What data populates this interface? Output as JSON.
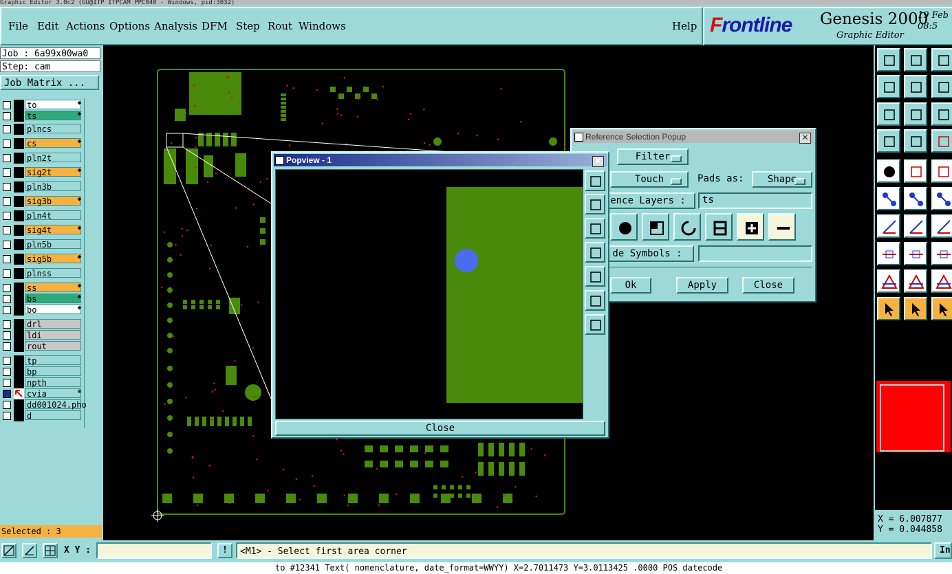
{
  "window": {
    "title": "Graphic Editor 3.0c2 (GU@ITP ITPCAM PPC040 - Windows, pid:3032)"
  },
  "menu": {
    "items": [
      "File",
      "Edit",
      "Actions",
      "Options",
      "Analysis",
      "DFM",
      "Step",
      "Rout",
      "Windows"
    ],
    "help": "Help"
  },
  "brand": {
    "logo_prefix": "F",
    "logo_rest": "rontline",
    "product": "Genesis 2000",
    "subtitle": "Graphic Editor",
    "date": "19 Feb",
    "time": "08:5"
  },
  "job": {
    "job_text": "Job : 6a99x00wa0",
    "step_text": "Step: cam",
    "matrix_button": "Job Matrix ..."
  },
  "layers": [
    {
      "name": "to",
      "color": "#ffffff",
      "mark": "◆"
    },
    {
      "name": "ts",
      "color": "#2fa87a",
      "mark": "◆"
    },
    {
      "name": "plncs",
      "color": "#9ed9d9",
      "mark": ""
    },
    {
      "name": "cs",
      "color": "#f5b240",
      "mark": "◆"
    },
    {
      "name": "pln2t",
      "color": "#9ed9d9",
      "mark": ""
    },
    {
      "name": "sig2t",
      "color": "#f5b240",
      "mark": "◆"
    },
    {
      "name": "pln3b",
      "color": "#9ed9d9",
      "mark": ""
    },
    {
      "name": "sig3b",
      "color": "#f5b240",
      "mark": "◆"
    },
    {
      "name": "pln4t",
      "color": "#9ed9d9",
      "mark": ""
    },
    {
      "name": "sig4t",
      "color": "#f5b240",
      "mark": "◆"
    },
    {
      "name": "pln5b",
      "color": "#9ed9d9",
      "mark": ""
    },
    {
      "name": "sig5b",
      "color": "#f5b240",
      "mark": "◆"
    },
    {
      "name": "plnss",
      "color": "#9ed9d9",
      "mark": ""
    },
    {
      "name": "ss",
      "color": "#f5b240",
      "mark": "◆"
    },
    {
      "name": "bs",
      "color": "#2fa87a",
      "mark": "◆"
    },
    {
      "name": "bo",
      "color": "#ffffff",
      "mark": "◆"
    },
    {
      "name": "drl",
      "color": "#c8c8c8",
      "mark": ""
    },
    {
      "name": "ldi",
      "color": "#c8c8c8",
      "mark": ""
    },
    {
      "name": "rout",
      "color": "#c8c8c8",
      "mark": ""
    },
    {
      "name": "tp",
      "color": "#9ed9d9",
      "mark": ""
    },
    {
      "name": "bp",
      "color": "#9ed9d9",
      "mark": ""
    },
    {
      "name": "npth",
      "color": "#9ed9d9",
      "mark": ""
    },
    {
      "name": "cvia",
      "color": "#9ed9d9",
      "mark": "⊞"
    },
    {
      "name": "dd001024.pho",
      "color": "#9ed9d9",
      "mark": ""
    },
    {
      "name": "d",
      "color": "#9ed9d9",
      "mark": ""
    }
  ],
  "selected_text": "Selected : 3",
  "coords": {
    "x": "X = 6.007877",
    "y": "Y = 0.044858"
  },
  "bottom": {
    "xy_label": "X Y :",
    "xy_value": "",
    "status": "<M1> - Select first area corner",
    "instr_button": "In"
  },
  "footer": "to #12341 Text( nomenclature, date_format=WWYY) X=2.7011473 Y=3.0113425 .0000 POS datecode",
  "popview": {
    "title": "Popview - 1",
    "close_label": "Close"
  },
  "refsel": {
    "title": "Reference Selection Popup",
    "filter_label": "Filter",
    "mode_value": "Touch",
    "pads_label": "Pads as:",
    "pads_value": "Shape",
    "ref_layers_label": "ence Layers :",
    "ref_layers_value": "ts",
    "symbols_label": "de Symbols :",
    "symbols_value": "",
    "ok_label": "Ok",
    "apply_label": "Apply",
    "close_label": "Close"
  },
  "colors": {
    "panel": "#9ed9d9",
    "pcb_copper": "#4a8a0a",
    "highlight": "#f5b240",
    "selected_pad": "#4a6cf0",
    "marker": "#ff0000"
  }
}
